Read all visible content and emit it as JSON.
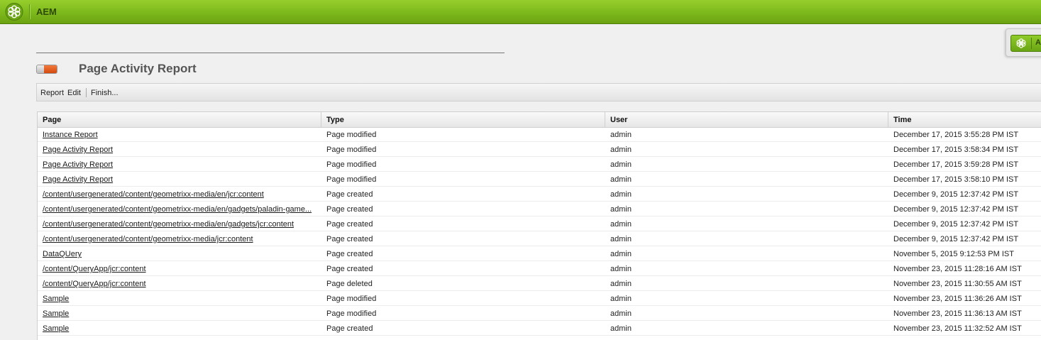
{
  "app": {
    "title": "AEM",
    "logo_icon": "adobe-aem-flower-icon",
    "brand_color": "#7db81c"
  },
  "sidekick": {
    "label": "A",
    "icon": "aem-flower-icon"
  },
  "report": {
    "title": "Page Activity Report",
    "toggle_icon": "toggle-switch-icon"
  },
  "toolbar": {
    "report_label": "Report",
    "edit_label": "Edit",
    "finish_label": "Finish..."
  },
  "table": {
    "columns": [
      "Page",
      "Type",
      "User",
      "Time"
    ],
    "rows": [
      [
        "Instance Report",
        "Page modified",
        "admin",
        "December 17, 2015 3:55:28 PM IST"
      ],
      [
        "Page Activity Report",
        "Page modified",
        "admin",
        "December 17, 2015 3:58:34 PM IST"
      ],
      [
        "Page Activity Report",
        "Page modified",
        "admin",
        "December 17, 2015 3:59:28 PM IST"
      ],
      [
        "Page Activity Report",
        "Page modified",
        "admin",
        "December 17, 2015 3:58:10 PM IST"
      ],
      [
        "/content/usergenerated/content/geometrixx-media/en/jcr:content",
        "Page created",
        "admin",
        "December 9, 2015 12:37:42 PM IST"
      ],
      [
        "/content/usergenerated/content/geometrixx-media/en/gadgets/paladin-game...",
        "Page created",
        "admin",
        "December 9, 2015 12:37:42 PM IST"
      ],
      [
        "/content/usergenerated/content/geometrixx-media/en/gadgets/jcr:content",
        "Page created",
        "admin",
        "December 9, 2015 12:37:42 PM IST"
      ],
      [
        "/content/usergenerated/content/geometrixx-media/jcr:content",
        "Page created",
        "admin",
        "December 9, 2015 12:37:42 PM IST"
      ],
      [
        "DataQUery",
        "Page created",
        "admin",
        "November 5, 2015 9:12:53 PM IST"
      ],
      [
        "/content/QueryApp/jcr:content",
        "Page created",
        "admin",
        "November 23, 2015 11:28:16 AM IST"
      ],
      [
        "/content/QueryApp/jcr:content",
        "Page deleted",
        "admin",
        "November 23, 2015 11:30:55 AM IST"
      ],
      [
        "Sample",
        "Page modified",
        "admin",
        "November 23, 2015 11:36:26 AM IST"
      ],
      [
        "Sample",
        "Page modified",
        "admin",
        "November 23, 2015 11:36:13 AM IST"
      ],
      [
        "Sample",
        "Page created",
        "admin",
        "November 23, 2015 11:32:52 AM IST"
      ]
    ]
  }
}
